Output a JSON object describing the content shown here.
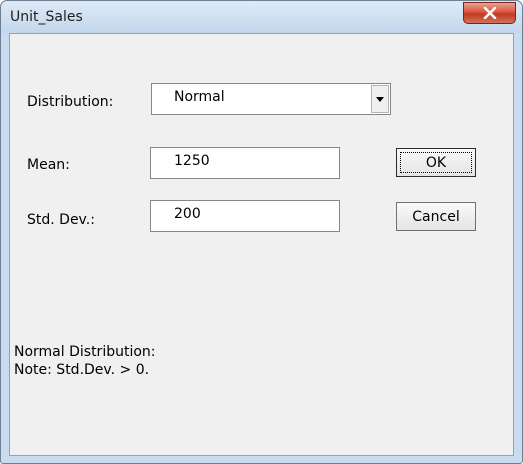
{
  "window": {
    "title": "Unit_Sales"
  },
  "form": {
    "distribution_label": "Distribution:",
    "distribution_value": "Normal",
    "mean_label": "Mean:",
    "mean_value": "1250",
    "stddev_label": "Std. Dev.:",
    "stddev_value": "200"
  },
  "buttons": {
    "ok": "OK",
    "cancel": "Cancel"
  },
  "info": {
    "line1": "Normal Distribution:",
    "line2": "Note: Std.Dev. > 0."
  }
}
